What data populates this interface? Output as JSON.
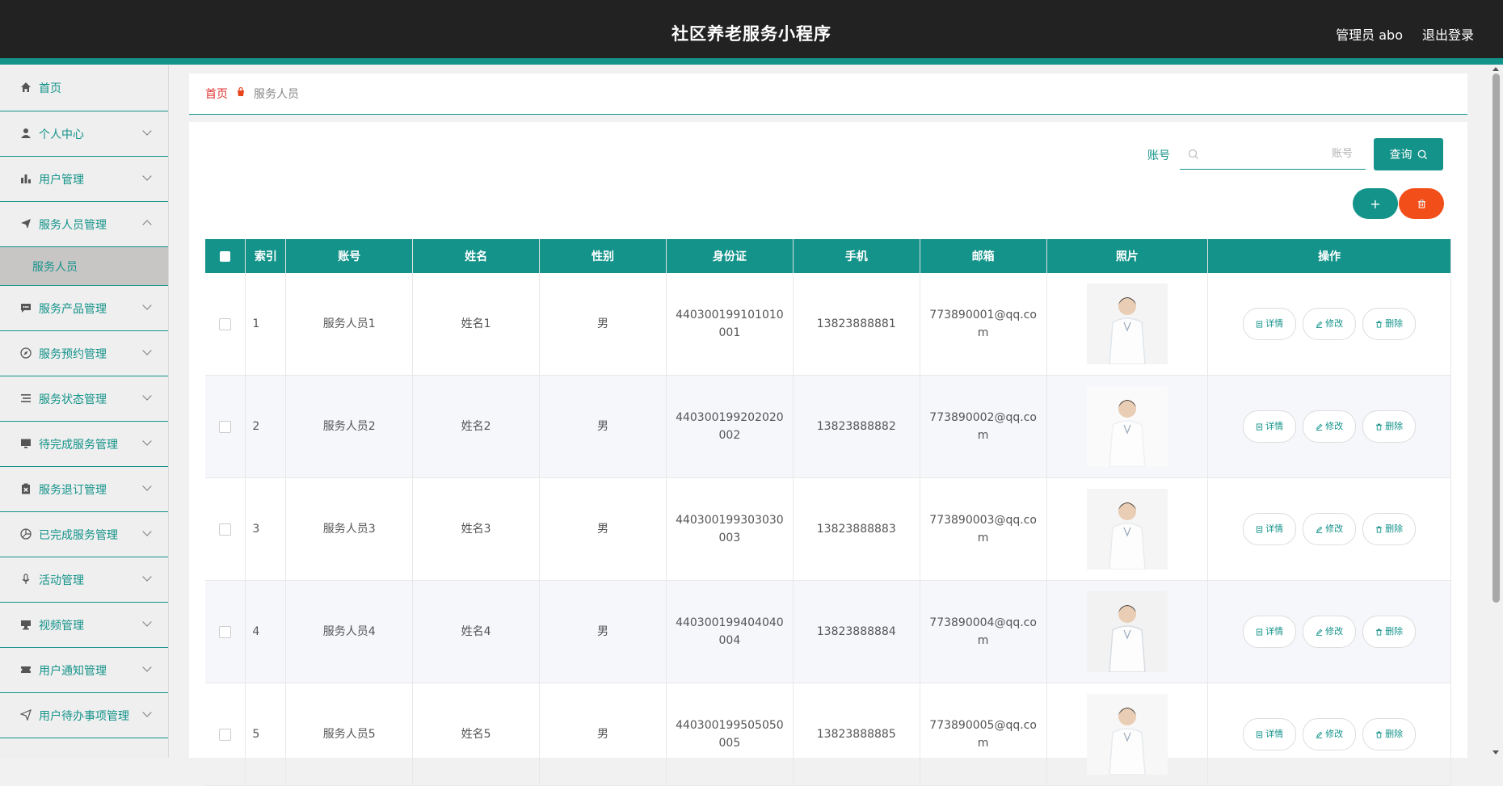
{
  "header": {
    "title": "社区养老服务小程序",
    "admin_label": "管理员 abo",
    "logout_label": "退出登录"
  },
  "sidebar": {
    "items": [
      {
        "label": "首页",
        "icon": "home-icon"
      },
      {
        "label": "个人中心",
        "icon": "user-icon"
      },
      {
        "label": "用户管理",
        "icon": "bar-chart-icon"
      },
      {
        "label": "服务人员管理",
        "icon": "send-icon"
      },
      {
        "label": "服务产品管理",
        "icon": "chat-icon"
      },
      {
        "label": "服务预约管理",
        "icon": "compass-icon"
      },
      {
        "label": "服务状态管理",
        "icon": "list-icon"
      },
      {
        "label": "待完成服务管理",
        "icon": "monitor-icon"
      },
      {
        "label": "服务退订管理",
        "icon": "clipboard-x-icon"
      },
      {
        "label": "已完成服务管理",
        "icon": "aperture-icon"
      },
      {
        "label": "活动管理",
        "icon": "mic-icon"
      },
      {
        "label": "视频管理",
        "icon": "video-icon"
      },
      {
        "label": "用户通知管理",
        "icon": "ticket-icon"
      },
      {
        "label": "用户待办事项管理",
        "icon": "send-outline-icon"
      }
    ],
    "sub_item": "服务人员"
  },
  "breadcrumb": {
    "home": "首页",
    "current": "服务人员"
  },
  "search": {
    "label": "账号",
    "placeholder": "账号",
    "button": "查询"
  },
  "actions": {
    "add": "+"
  },
  "table": {
    "headers": [
      "索引",
      "账号",
      "姓名",
      "性别",
      "身份证",
      "手机",
      "邮箱",
      "照片",
      "操作"
    ],
    "op_labels": {
      "detail": "详情",
      "edit": "修改",
      "delete": "删除"
    },
    "rows": [
      {
        "index": "1",
        "account": "服务人员1",
        "name": "姓名1",
        "gender": "男",
        "id_card": "440300199101010001",
        "phone": "13823888881",
        "email": "773890001@qq.com"
      },
      {
        "index": "2",
        "account": "服务人员2",
        "name": "姓名2",
        "gender": "男",
        "id_card": "440300199202020002",
        "phone": "13823888882",
        "email": "773890002@qq.com"
      },
      {
        "index": "3",
        "account": "服务人员3",
        "name": "姓名3",
        "gender": "男",
        "id_card": "440300199303030003",
        "phone": "13823888883",
        "email": "773890003@qq.com"
      },
      {
        "index": "4",
        "account": "服务人员4",
        "name": "姓名4",
        "gender": "男",
        "id_card": "440300199404040004",
        "phone": "13823888884",
        "email": "773890004@qq.com"
      },
      {
        "index": "5",
        "account": "服务人员5",
        "name": "姓名5",
        "gender": "男",
        "id_card": "440300199505050005",
        "phone": "13823888885",
        "email": "773890005@qq.com"
      }
    ]
  },
  "colors": {
    "accent": "#14938a",
    "danger": "#f24e19",
    "header_bg": "#222222"
  }
}
